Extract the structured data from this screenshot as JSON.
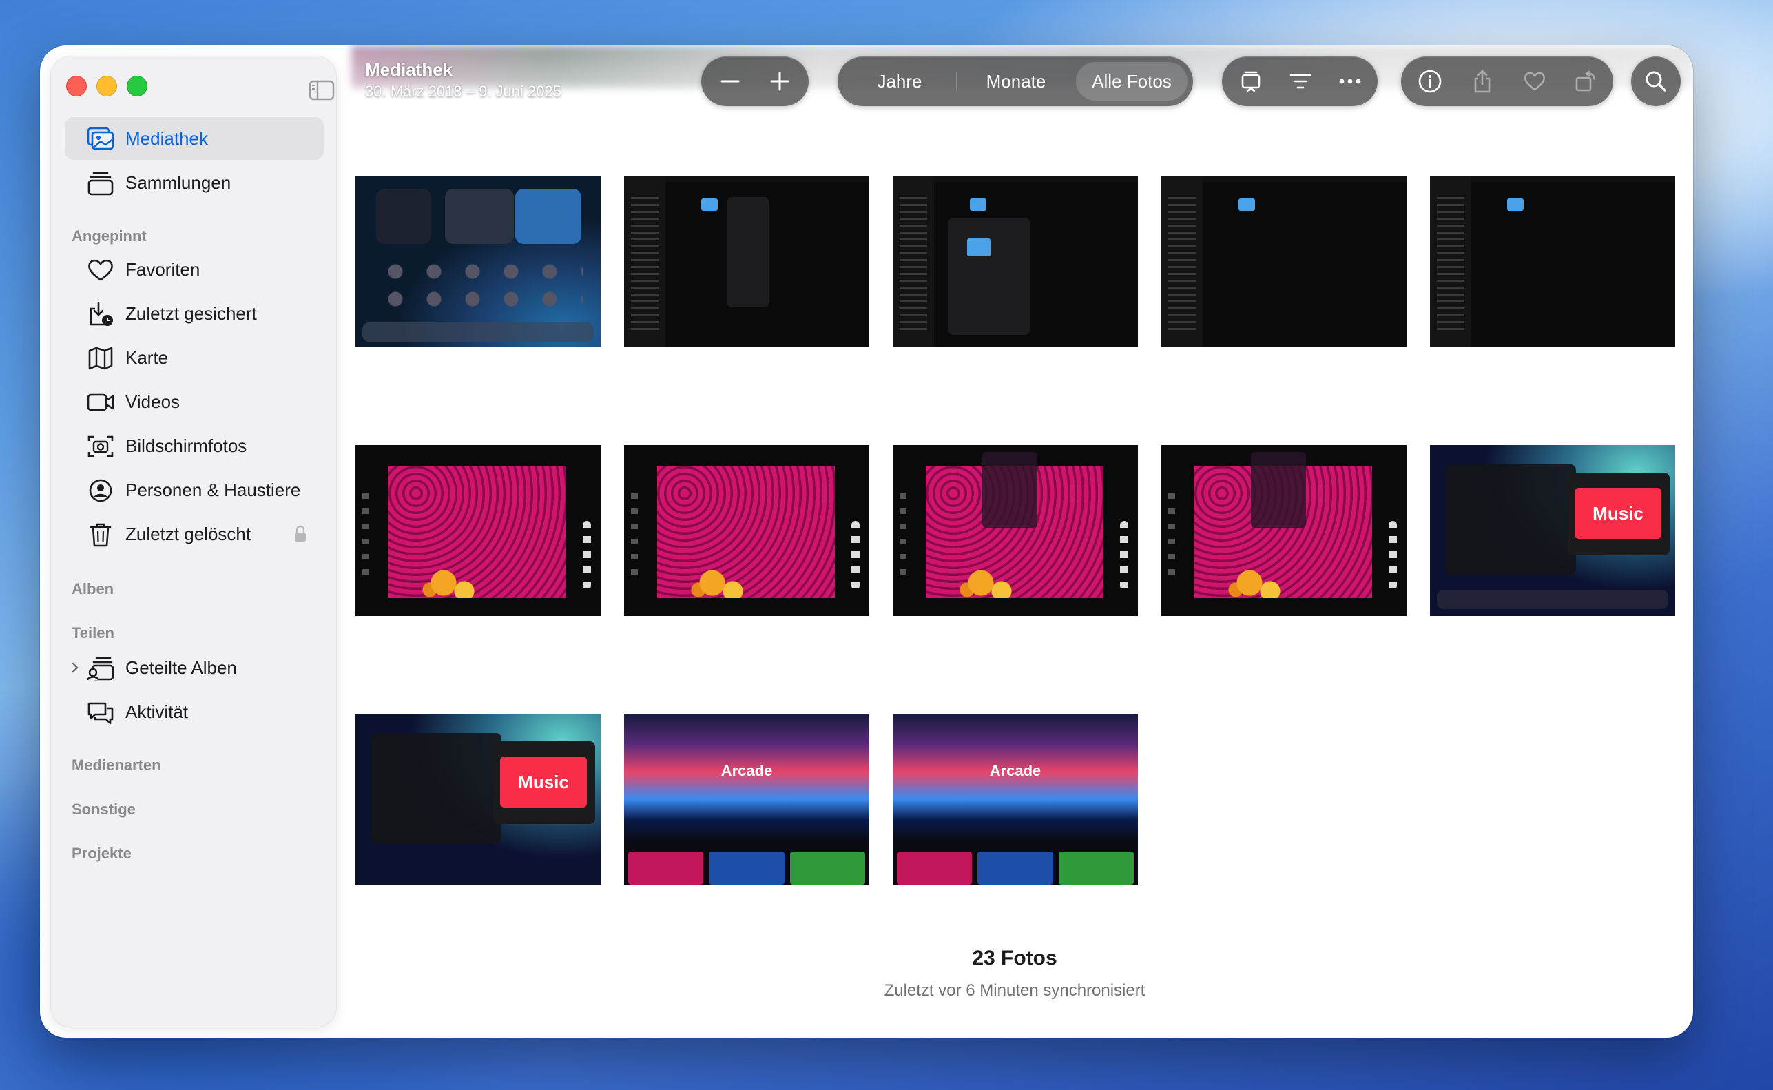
{
  "window": {
    "title": "Mediathek",
    "subtitle": "30. März 2018 – 9. Juni 2025"
  },
  "sidebar": {
    "items": [
      {
        "label": "Mediathek",
        "icon": "photo-library-icon",
        "selected": true
      },
      {
        "label": "Sammlungen",
        "icon": "collections-icon"
      }
    ],
    "pinned_header": "Angepinnt",
    "pinned": [
      {
        "label": "Favoriten",
        "icon": "heart-icon"
      },
      {
        "label": "Zuletzt gesichert",
        "icon": "recently-saved-icon"
      },
      {
        "label": "Karte",
        "icon": "map-icon"
      },
      {
        "label": "Videos",
        "icon": "video-icon"
      },
      {
        "label": "Bildschirmfotos",
        "icon": "screenshot-icon"
      },
      {
        "label": "Personen & Haustiere",
        "icon": "person-icon"
      },
      {
        "label": "Zuletzt gelöscht",
        "icon": "trash-icon",
        "locked": true
      }
    ],
    "albums_header": "Alben",
    "share_header": "Teilen",
    "share": [
      {
        "label": "Geteilte Alben",
        "icon": "shared-albums-icon"
      },
      {
        "label": "Aktivität",
        "icon": "activity-icon"
      }
    ],
    "media_types_header": "Medienarten",
    "other_header": "Sonstige",
    "projects_header": "Projekte"
  },
  "toolbar": {
    "segments": [
      "Jahre",
      "Monate",
      "Alle Fotos"
    ],
    "selected_segment": "Alle Fotos",
    "icons": [
      "zoom-out-icon",
      "zoom-in-icon",
      "slideshow-icon",
      "filter-icon",
      "more-icon",
      "info-icon",
      "share-icon",
      "favorite-icon",
      "rotate-icon",
      "search-icon"
    ]
  },
  "thumbnail_texts": {
    "music": "Music",
    "arcade": "Arcade"
  },
  "footer": {
    "count": "23 Fotos",
    "sync": "Zuletzt vor 6 Minuten synchronisiert"
  },
  "colors": {
    "accent": "#0a64d8",
    "close": "#fe5f57",
    "minimize": "#febc2e",
    "zoom": "#28c840"
  }
}
